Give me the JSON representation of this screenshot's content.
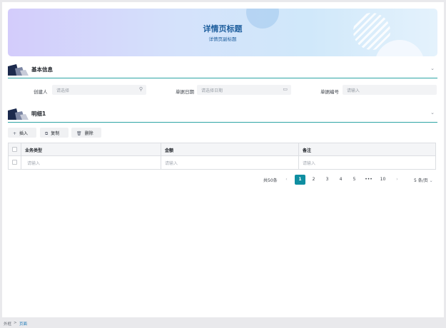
{
  "banner": {
    "title": "详情页标题",
    "subtitle": "详情页副标题"
  },
  "sections": {
    "basic": {
      "title": "基本信息"
    },
    "detail": {
      "title": "明细1"
    }
  },
  "form": {
    "creator": {
      "label": "创建人",
      "placeholder": "请选择"
    },
    "date": {
      "label": "单据日期",
      "placeholder": "请选择日期"
    },
    "number": {
      "label": "单据编号",
      "placeholder": "请输入"
    }
  },
  "toolbar": {
    "insert": "插入",
    "copy": "复制",
    "delete": "删除"
  },
  "table": {
    "columns": [
      "业务类型",
      "金额",
      "备注"
    ],
    "rows": [
      [
        "请输入",
        "请输入",
        "请输入"
      ]
    ]
  },
  "pagination": {
    "total": "共50条",
    "pages": [
      "1",
      "2",
      "3",
      "4",
      "5"
    ],
    "ellipsis": "•••",
    "last": "10",
    "current": "1",
    "page_size": "5 条/页"
  },
  "breadcrumb": {
    "parent": "外框",
    "separator": ">",
    "current": "页面"
  },
  "colors": {
    "accent": "#0f8ea1",
    "section_line": "#2ea5a5",
    "banner_text": "#1f5f9e"
  }
}
